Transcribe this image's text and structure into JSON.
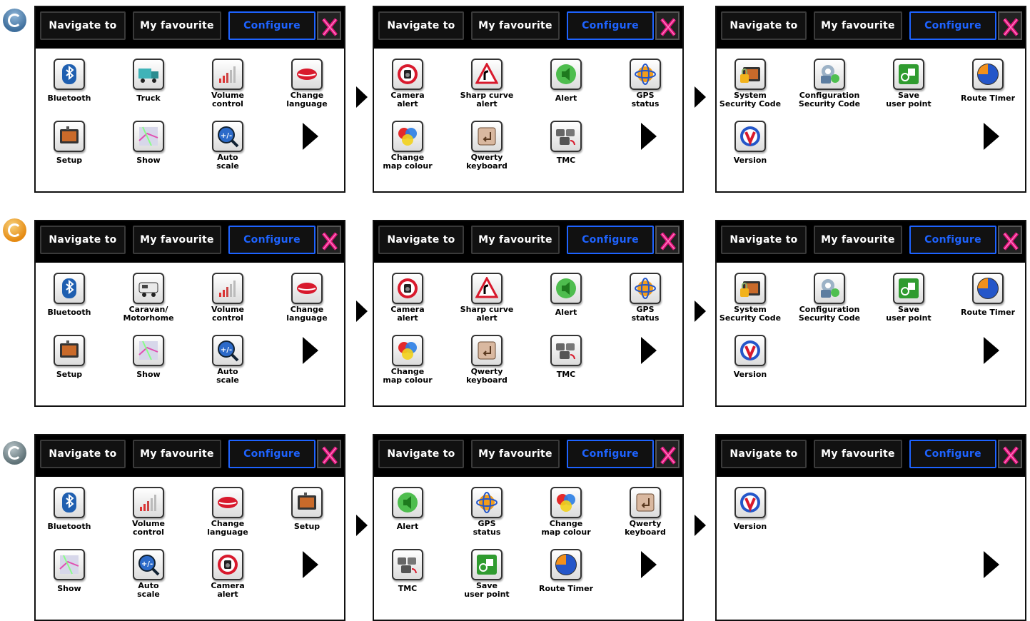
{
  "tabs": {
    "navigate": "Navigate to",
    "favourite": "My favourite",
    "configure": "Configure"
  },
  "colors": {
    "configure_accent": "#1e63ff",
    "close_icon": "#e0107a"
  },
  "rows": [
    {
      "screens": [
        {
          "items": [
            {
              "label": "Bluetooth",
              "icon": "bluetooth-icon"
            },
            {
              "label": "Truck",
              "icon": "truck-icon"
            },
            {
              "label": "Volume\ncontrol",
              "icon": "volume-icon"
            },
            {
              "label": "Change\nlanguage",
              "icon": "lips-icon"
            },
            {
              "label": "Setup",
              "icon": "device-icon"
            },
            {
              "label": "Show",
              "icon": "map-icon"
            },
            {
              "label": "Auto\nscale",
              "icon": "zoom-icon"
            }
          ]
        },
        {
          "items": [
            {
              "label": "Camera\nalert",
              "icon": "camera-icon"
            },
            {
              "label": "Sharp curve\nalert",
              "icon": "curve-icon"
            },
            {
              "label": "Alert",
              "icon": "speaker-icon"
            },
            {
              "label": "GPS\nstatus",
              "icon": "satellite-icon"
            },
            {
              "label": "Change\nmap colour",
              "icon": "color-icon"
            },
            {
              "label": "Qwerty\nkeyboard",
              "icon": "keyboard-icon"
            },
            {
              "label": "TMC",
              "icon": "traffic-icon"
            }
          ]
        },
        {
          "items": [
            {
              "label": "System\nSecurity Code",
              "icon": "lock-device-icon"
            },
            {
              "label": "Configuration\nSecurity Code",
              "icon": "lock-gear-icon"
            },
            {
              "label": "Save\nuser point",
              "icon": "save-point-icon"
            },
            {
              "label": "Route Timer",
              "icon": "timer-icon"
            },
            {
              "label": "Version",
              "icon": "version-icon"
            }
          ]
        }
      ]
    },
    {
      "screens": [
        {
          "items": [
            {
              "label": "Bluetooth",
              "icon": "bluetooth-icon"
            },
            {
              "label": "Caravan/\nMotorhome",
              "icon": "caravan-icon"
            },
            {
              "label": "Volume\ncontrol",
              "icon": "volume-icon"
            },
            {
              "label": "Change\nlanguage",
              "icon": "lips-icon"
            },
            {
              "label": "Setup",
              "icon": "device-icon"
            },
            {
              "label": "Show",
              "icon": "map-icon"
            },
            {
              "label": "Auto\nscale",
              "icon": "zoom-icon"
            }
          ]
        },
        {
          "items": [
            {
              "label": "Camera\nalert",
              "icon": "camera-icon"
            },
            {
              "label": "Sharp curve\nalert",
              "icon": "curve-icon"
            },
            {
              "label": "Alert",
              "icon": "speaker-icon"
            },
            {
              "label": "GPS\nstatus",
              "icon": "satellite-icon"
            },
            {
              "label": "Change\nmap colour",
              "icon": "color-icon"
            },
            {
              "label": "Qwerty\nkeyboard",
              "icon": "keyboard-icon"
            },
            {
              "label": "TMC",
              "icon": "traffic-icon"
            }
          ]
        },
        {
          "items": [
            {
              "label": "System\nSecurity Code",
              "icon": "lock-device-icon"
            },
            {
              "label": "Configuration\nSecurity Code",
              "icon": "lock-gear-icon"
            },
            {
              "label": "Save\nuser point",
              "icon": "save-point-icon"
            },
            {
              "label": "Route Timer",
              "icon": "timer-icon"
            },
            {
              "label": "Version",
              "icon": "version-icon"
            }
          ]
        }
      ]
    },
    {
      "screens": [
        {
          "items": [
            {
              "label": "Bluetooth",
              "icon": "bluetooth-icon"
            },
            {
              "label": "Volume\ncontrol",
              "icon": "volume-icon"
            },
            {
              "label": "Change\nlanguage",
              "icon": "lips-icon"
            },
            {
              "label": "Setup",
              "icon": "device-icon"
            },
            {
              "label": "Show",
              "icon": "map-icon"
            },
            {
              "label": "Auto\nscale",
              "icon": "zoom-icon"
            },
            {
              "label": "Camera\nalert",
              "icon": "camera-icon"
            }
          ]
        },
        {
          "items": [
            {
              "label": "Alert",
              "icon": "speaker-icon"
            },
            {
              "label": "GPS\nstatus",
              "icon": "satellite-icon"
            },
            {
              "label": "Change\nmap colour",
              "icon": "color-icon"
            },
            {
              "label": "Qwerty\nkeyboard",
              "icon": "keyboard-icon"
            },
            {
              "label": "TMC",
              "icon": "traffic-icon"
            },
            {
              "label": "Save\nuser point",
              "icon": "save-point-icon"
            },
            {
              "label": "Route Timer",
              "icon": "timer-icon"
            }
          ]
        },
        {
          "items": [
            {
              "label": "Version",
              "icon": "version-icon"
            }
          ]
        }
      ]
    }
  ]
}
